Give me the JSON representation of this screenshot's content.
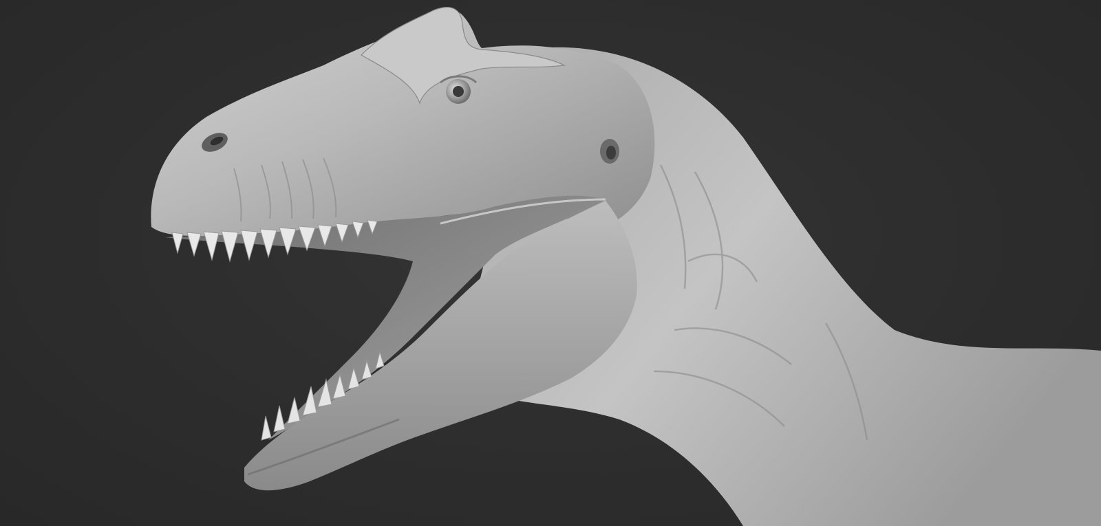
{
  "scene": {
    "background_color": "#2d2d2d",
    "subject": "dinosaur-head-sculpt",
    "material_color": "#b8b8b8"
  }
}
